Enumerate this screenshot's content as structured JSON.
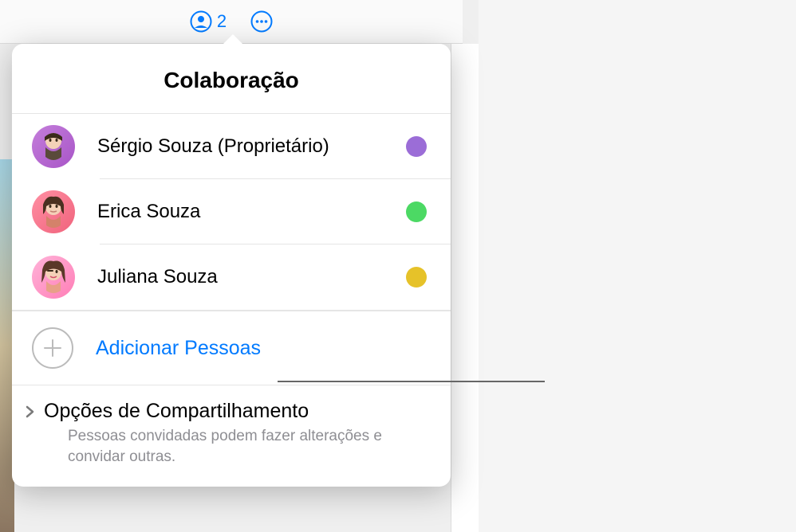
{
  "toolbar": {
    "collab_count": "2"
  },
  "popover": {
    "title": "Colaboração",
    "collaborators": [
      {
        "name": "Sérgio Souza (Proprietário)",
        "avatar_bg": "linear-gradient(135deg, #c47edb 0%, #a855c7 100%)",
        "status_color": "#9b6dd7"
      },
      {
        "name": "Erica Souza",
        "avatar_bg": "linear-gradient(135deg, #ff8fa3 0%, #f0637c 100%)",
        "status_color": "#4cd964"
      },
      {
        "name": "Juliana Souza",
        "avatar_bg": "linear-gradient(135deg, #ffb3d9 0%, #ff7eb6 100%)",
        "status_color": "#e6c229"
      }
    ],
    "add_label": "Adicionar Pessoas",
    "sharing": {
      "title": "Opções de Compartilhamento",
      "description": "Pessoas convidadas podem fazer alterações e convidar outras."
    }
  }
}
